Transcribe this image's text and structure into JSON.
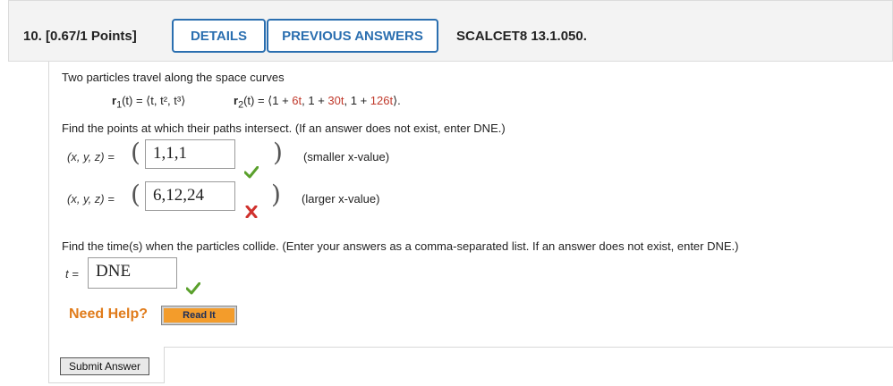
{
  "header": {
    "question_number": "10.",
    "points": "[0.67/1 Points]",
    "details_label": "DETAILS",
    "previous_answers_label": "PREVIOUS ANSWERS",
    "problem_code": "SCALCET8 13.1.050."
  },
  "problem": {
    "intro": "Two particles travel along the space curves",
    "r1_name": "r",
    "r1_sub": "1",
    "r1_expr": "(t) = ⟨t, t², t³⟩",
    "r2_name": "r",
    "r2_sub": "2",
    "r2_part1": "(t) = ⟨1 + ",
    "r2_coef1": "6t",
    "r2_part2": ", 1 + ",
    "r2_coef2": "30t",
    "r2_part3": ", 1 + ",
    "r2_coef3": "126t",
    "r2_part4": "⟩.",
    "find_points": "Find the points at which their paths intersect. (If an answer does not exist, enter DNE.)",
    "coord_label": "(x, y, z)  =",
    "answer1": "1,1,1",
    "answer1_hint": "(smaller x-value)",
    "answer1_status": "correct",
    "answer2": "6,12,24",
    "answer2_hint": "(larger x-value)",
    "answer2_status": "incorrect",
    "find_time": "Find the time(s) when the particles collide. (Enter your answers as a comma-separated list. If an answer does not exist, enter DNE.)",
    "t_label": "t =",
    "answer3": "DNE",
    "answer3_status": "correct"
  },
  "help": {
    "need_help": "Need Help?",
    "read_it": "Read It"
  },
  "submit_label": "Submit Answer",
  "colors": {
    "accent": "#2b6fb0",
    "correct": "#5aa02c",
    "incorrect": "#d0312d",
    "help": "#e07b1a"
  }
}
